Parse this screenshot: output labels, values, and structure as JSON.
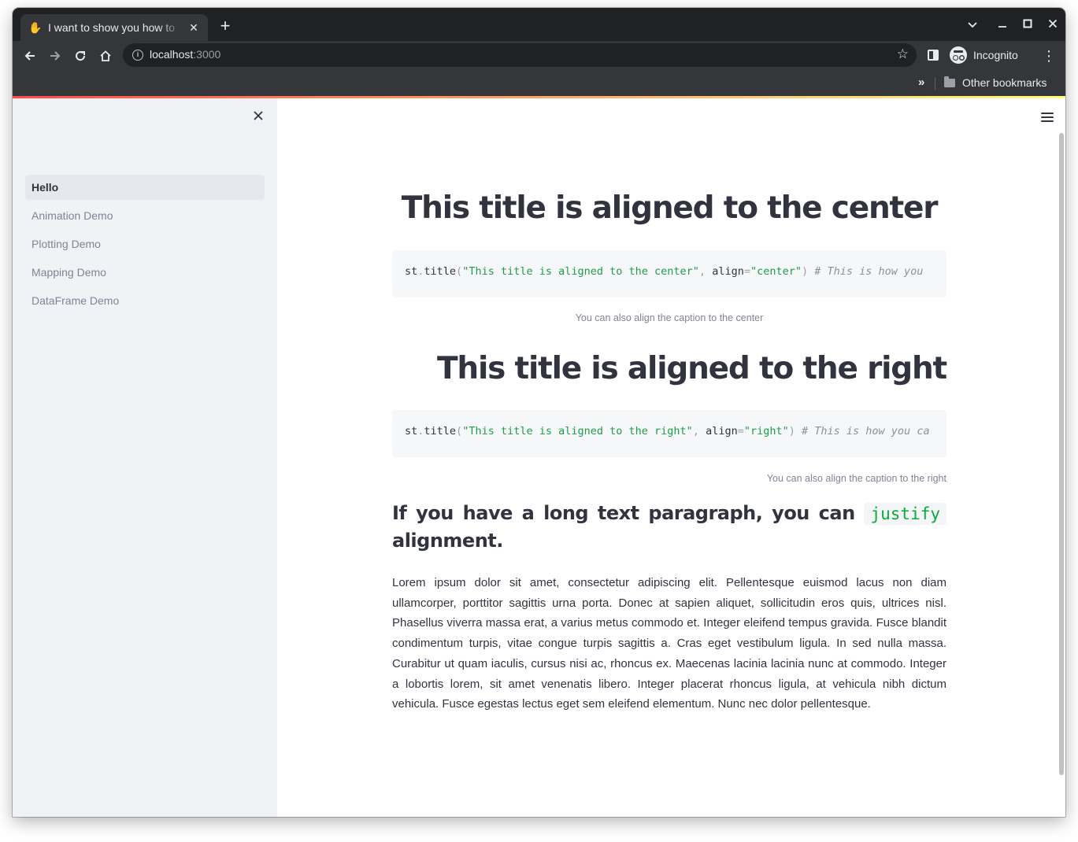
{
  "browser": {
    "tab_title": "I want to show you how to",
    "new_tab": "+",
    "url_host": "localhost",
    "url_port": ":3000",
    "profile_label": "Incognito",
    "bookmarks_overflow": "»",
    "other_bookmarks": "Other bookmarks"
  },
  "sidebar": {
    "items": [
      {
        "label": "Hello",
        "active": true
      },
      {
        "label": "Animation Demo",
        "active": false
      },
      {
        "label": "Plotting Demo",
        "active": false
      },
      {
        "label": "Mapping Demo",
        "active": false
      },
      {
        "label": "DataFrame Demo",
        "active": false
      }
    ]
  },
  "main": {
    "title_center": "This title is aligned to the center",
    "code_center": {
      "obj": "st",
      "dot": ".",
      "fn": "title",
      "open": "(",
      "arg": "\"This title is aligned to the center\"",
      "comma": ", ",
      "kw": "align",
      "eq": "=",
      "val": "\"center\"",
      "close": ")",
      "comment": " # This is how you"
    },
    "caption_center": "You can also align the caption to the center",
    "title_right": "This title is aligned to the right",
    "code_right": {
      "obj": "st",
      "dot": ".",
      "fn": "title",
      "open": "(",
      "arg": "\"This title is aligned to the right\"",
      "comma": ", ",
      "kw": "align",
      "eq": "=",
      "val": "\"right\"",
      "close": ")",
      "comment": " # This is how you ca"
    },
    "caption_right": "You can also align the caption to the right",
    "subheader_prefix": "If you have a long text paragraph, you can",
    "subheader_code": "justify",
    "subheader_suffix": "alignment.",
    "paragraph": "Lorem ipsum dolor sit amet, consectetur adipiscing elit. Pellentesque euismod lacus non diam ullamcorper, porttitor sagittis urna porta. Donec at sapien aliquet, sollicitudin eros quis, ultrices nisl. Phasellus viverra massa erat, a varius metus commodo et. Integer eleifend tempus gravida. Fusce blandit condimentum turpis, vitae congue turpis sagittis a. Cras eget vestibulum ligula. In sed nulla massa. Curabitur ut quam iaculis, cursus nisi ac, rhoncus ex. Maecenas lacinia lacinia nunc at commodo. Integer a lobortis lorem, sit amet venenatis libero. Integer placerat rhoncus ligula, at vehicula nibh dictum vehicula. Fusce egestas lectus eget sem eleifend elementum. Nunc nec dolor pellentesque."
  },
  "colors": {
    "accent_start": "#ff4b4b",
    "accent_end": "#fffd80",
    "sidebar_bg": "#f0f2f6",
    "text": "#31333f",
    "code_string": "#1f9c4a",
    "inline_code": "#09ab3b"
  },
  "icons": {
    "favicon": "waving-hand-icon",
    "tab_close": "close-icon",
    "back": "arrow-left-icon",
    "forward": "arrow-right-icon",
    "reload": "reload-icon",
    "home": "home-icon",
    "site_info": "info-icon",
    "bookmark": "star-icon",
    "side_panel": "side-panel-icon",
    "incognito": "incognito-icon",
    "menu": "kebab-menu-icon",
    "folder": "folder-icon",
    "sidebar_close": "close-icon",
    "app_menu": "hamburger-icon"
  }
}
